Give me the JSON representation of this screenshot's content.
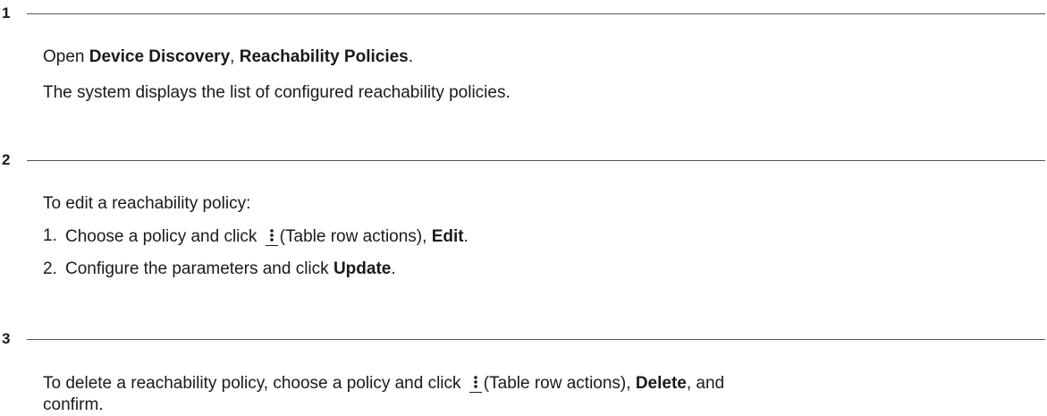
{
  "steps": [
    {
      "number": "1",
      "paragraphs": [
        {
          "open": "Open ",
          "b1": "Device Discovery",
          "sep": ", ",
          "b2": "Reachability Policies",
          "end": "."
        },
        {
          "text": "The system displays the list of configured reachability policies."
        }
      ]
    },
    {
      "number": "2",
      "intro": "To edit a reachability policy:",
      "items": [
        {
          "num": "1.",
          "pre": "Choose a policy and click ",
          "icon_name": "kebab-icon",
          "icon_label": "(Table row actions), ",
          "bold": "Edit",
          "end": "."
        },
        {
          "num": "2.",
          "pre": "Configure the parameters and click ",
          "bold": "Update",
          "end": "."
        }
      ]
    },
    {
      "number": "3",
      "pre": "To delete a reachability policy, choose a policy and click ",
      "icon_name": "kebab-icon",
      "icon_label": "(Table row actions), ",
      "bold": "Delete",
      "post": ", and confirm."
    }
  ]
}
